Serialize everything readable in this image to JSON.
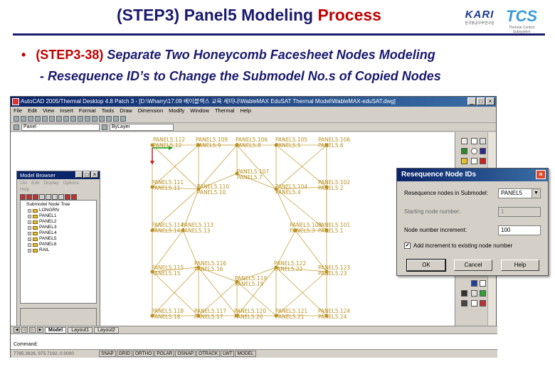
{
  "slide": {
    "title_main": "(STEP3) Panel5 Modeling ",
    "title_highlight": "Process",
    "bullet_marker": "•",
    "bullet_step": "(STEP3-38)",
    "bullet_desc": " Separate Two Honeycomb Facesheet Nodes Modeling",
    "sub_bullet": "-  Resequence ID’s to Change the Submodel No.s of Copied Nodes",
    "logo_kari": "KARI",
    "logo_kari_sub": "한국항공우주연구원",
    "logo_tcs": "TCS",
    "logo_tcs_sub": "Thermal Control Subsystem"
  },
  "window": {
    "title": "AutoCAD 2005/Thermal Desktop 4.8 Patch 3 - [D:\\Wharry\\17.09 베이블렉스 교육 세미나\\WableMAX EduSAT Thermal Model\\WableMAX-eduSAT.dwg]",
    "menus": [
      "File",
      "Edit",
      "View",
      "Insert",
      "Format",
      "Tools",
      "Draw",
      "Dimension",
      "Modify",
      "Window",
      "Thermal",
      "Help"
    ],
    "layer_combo": "Panel",
    "linetype_combo": "ByLayer",
    "minimize": "_",
    "maximize": "□",
    "close": "×"
  },
  "model_browser": {
    "title": "Model Browser",
    "menus": [
      "List",
      "Edit",
      "Display",
      "Options",
      "Help"
    ],
    "tree_root": "Submodel Node Tree",
    "tree_items": [
      "LONGRN",
      "PANEL1",
      "PANEL2",
      "PANEL3",
      "PANEL4",
      "PANEL5",
      "PANEL6",
      "RAIL"
    ]
  },
  "drawing": {
    "labels_top": [
      "PANEL5.112",
      "PANEL5.109",
      "PANEL5.106",
      "PANEL5.105",
      "PANEL5.106"
    ],
    "labels_top_sub": [
      "PANEL5.12",
      "PANEL5.9",
      "PANEL5.8",
      "PANEL5.5",
      "PANEL5.6"
    ],
    "labels_misc": [
      "PANEL5.107",
      "PANEL5.111",
      "PANEL5.110",
      "PANEL5.104",
      "PANEL5.102",
      "PANEL5.11",
      "PANEL5.10",
      "PANEL5.4",
      "PANEL5.2",
      "PANEL5.114",
      "PANEL5.113",
      "PANEL5.103",
      "PANEL5.101",
      "PANEL5.14",
      "PANEL5.13",
      "PANEL5.3",
      "PANEL5.1",
      "PANEL5.115",
      "PANEL5.116",
      "PANEL5.122",
      "PANEL5.123",
      "PANEL5.15",
      "PANEL5.16",
      "PANEL5.22",
      "PANEL5.23",
      "PANEL5.119",
      "PANEL5.19",
      "PANEL5.118",
      "PANEL5.117",
      "PANEL5.120",
      "PANEL5.121",
      "PANEL5.124",
      "PANEL5.18",
      "PANEL5.17",
      "PANEL5.20",
      "PANEL5.21",
      "PANEL5.24",
      "PANEL5.7"
    ]
  },
  "tabs": [
    "Model",
    "Layout1",
    "Layout2"
  ],
  "command": "Command:",
  "coords": "7785.3826, 975.7192, 0.0000",
  "status_buttons": [
    "SNAP",
    "GRID",
    "ORTHO",
    "POLAR",
    "OSNAP",
    "OTRACK",
    "LWT",
    "MODEL"
  ],
  "dialog": {
    "title": "Resequence Node IDs",
    "close": "×",
    "submodel_label": "Resequence nodes in Submodel:",
    "submodel_value": "PANEL5",
    "start_label": "Starting node number:",
    "start_value": "1",
    "increment_label": "Node number increment:",
    "increment_value": "100",
    "checkbox_label": "Add increment to existing node number",
    "checkbox_checked": true,
    "check_mark": "✔",
    "ok": "OK",
    "cancel": "Cancel",
    "help": "Help"
  },
  "colors": {
    "title_blue": "#1a1a6e",
    "highlight_red": "#c00000",
    "mesh": "#c8a03c",
    "node": "#b89020"
  }
}
